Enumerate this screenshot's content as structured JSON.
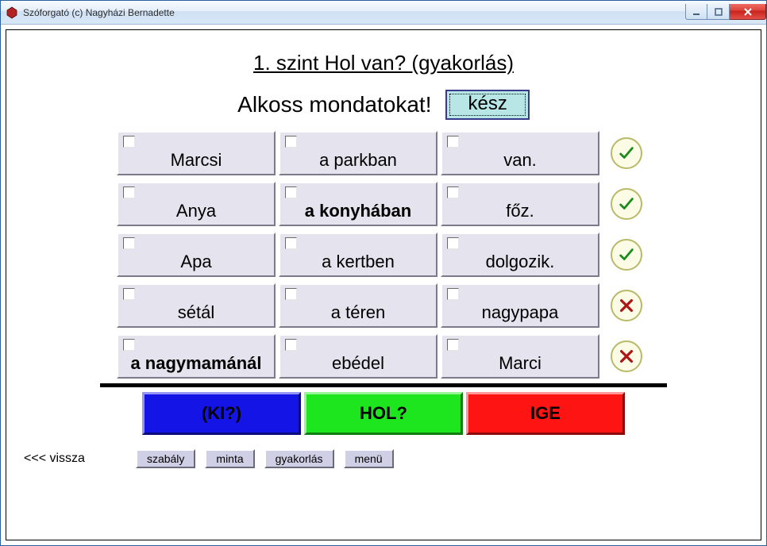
{
  "window": {
    "title": "Szóforgató (c) Nagyházi Bernadette"
  },
  "heading": "1. szint   Hol van? (gyakorlás)",
  "subtitle": "Alkoss mondatokat!",
  "done_label": "kész",
  "rows": [
    {
      "cells": [
        "Marcsi",
        "a parkban",
        "van."
      ],
      "bold": [
        false,
        false,
        false
      ],
      "status": "ok"
    },
    {
      "cells": [
        "Anya",
        "a konyhában",
        "főz."
      ],
      "bold": [
        false,
        true,
        false
      ],
      "status": "ok"
    },
    {
      "cells": [
        "Apa",
        "a kertben",
        "dolgozik."
      ],
      "bold": [
        false,
        false,
        false
      ],
      "status": "ok"
    },
    {
      "cells": [
        "sétál",
        "a téren",
        "nagypapa"
      ],
      "bold": [
        false,
        false,
        false
      ],
      "status": "bad"
    },
    {
      "cells": [
        "a nagymamánál",
        "ebédel",
        "Marci"
      ],
      "bold": [
        true,
        false,
        false
      ],
      "status": "bad"
    }
  ],
  "categories": [
    {
      "label": "(KI?)",
      "color": "blue"
    },
    {
      "label": "HOL?",
      "color": "green"
    },
    {
      "label": "IGE",
      "color": "red"
    }
  ],
  "bottom": {
    "back": "<<< vissza",
    "buttons": [
      "szabály",
      "minta",
      "gyakorlás",
      "menü"
    ]
  }
}
